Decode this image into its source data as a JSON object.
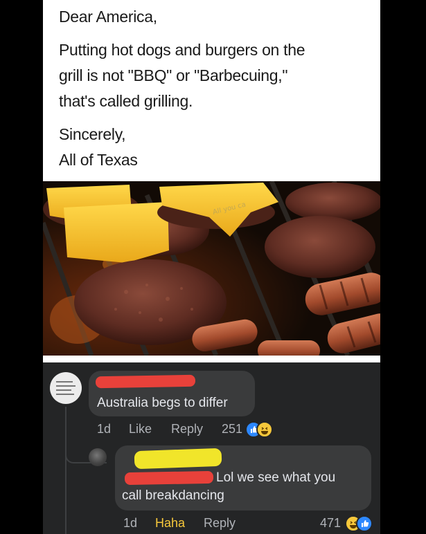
{
  "post": {
    "lines": [
      "Dear America,",
      "Putting hot dogs and burgers on the",
      "grill is not \"BBQ\" or \"Barbecuing,\"",
      "that's called grilling.",
      "Sincerely,",
      "All of Texas"
    ],
    "watermark": "All you ca"
  },
  "comments": [
    {
      "text": "Australia begs to differ",
      "age": "1d",
      "actions": [
        "Like",
        "Reply"
      ],
      "reaction_count": "251",
      "reactions": [
        "like-icon",
        "haha-icon"
      ]
    },
    {
      "text_line1": "Lol we see what you",
      "text_line2": "call breakdancing",
      "age": "1d",
      "actions": [
        "Haha",
        "Reply"
      ],
      "reaction_count": "471",
      "reactions": [
        "haha-icon",
        "like-icon"
      ],
      "haha_color": "#f7c83b"
    }
  ],
  "colors": {
    "redaction_red": "#e8413a",
    "redaction_yellow": "#f1e52a",
    "comment_bg": "#242526",
    "bubble_bg": "#3a3b3c",
    "like_blue": "#2d88ff"
  }
}
